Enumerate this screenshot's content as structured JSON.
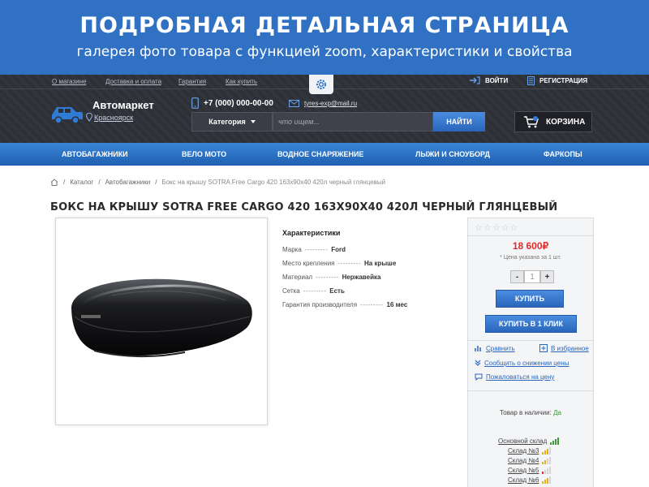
{
  "banner": {
    "title": "ПОДРОБНАЯ ДЕТАЛЬНАЯ СТРАНИЦА",
    "subtitle": "галерея фото товара с функцией zoom, характеристики и свойства"
  },
  "header": {
    "links": [
      "О магазине",
      "Доставка и оплата",
      "Гарантия",
      "Как купить"
    ],
    "login": "ВОЙТИ",
    "register": "РЕГИСТРАЦИЯ",
    "logo_name": "Автомаркет",
    "city": "Красноярск",
    "phone": "+7 (000) 000-00-00",
    "email": "tyres-exp@mail.ru",
    "category_label": "Категория",
    "search_placeholder": "что ищем...",
    "search_button": "НАЙТИ",
    "cart_label": "КОРЗИНА"
  },
  "nav": [
    "АВТОБАГАЖНИКИ",
    "ВЕЛО МОТО",
    "ВОДНОЕ СНАРЯЖЕНИЕ",
    "ЛЫЖИ И СНОУБОРД",
    "ФАРКОПЫ"
  ],
  "breadcrumb": {
    "separator": "/",
    "items": [
      "Каталог",
      "Автобагажники"
    ],
    "current": "Бокс на крышу SOTRA Free Cargo 420 163х90х40 420л черный глянцевый"
  },
  "product": {
    "title": "БОКС НА КРЫШУ SOTRA FREE CARGO 420 163Х90Х40 420Л ЧЕРНЫЙ ГЛЯНЦЕВЫЙ",
    "specs_title": "Характеристики",
    "specs": [
      {
        "name": "Марка",
        "value": "Ford"
      },
      {
        "name": "Место крепления",
        "value": "На крыше"
      },
      {
        "name": "Материал",
        "value": "Нержавейка"
      },
      {
        "name": "Сетка",
        "value": "Есть"
      },
      {
        "name": "Гарантия производителя",
        "value": "16 мес"
      }
    ]
  },
  "buy": {
    "rating": 0,
    "price": "18 600₽",
    "price_note": "* Цена указана за 1 шт.",
    "qty_minus": "-",
    "qty_value": "1",
    "qty_plus": "+",
    "buy_button": "КУПИТЬ",
    "one_click_button": "КУПИТЬ В 1 КЛИК",
    "compare": "Сравнить",
    "favorite": "В избранное",
    "notify": "Сообщить о снижении цены",
    "complain": "Пожаловаться на цену",
    "stock_label": "Товар в наличии:",
    "stock_value": "Да",
    "warehouses": [
      {
        "name": "Основной склад",
        "level": 4,
        "color": "#3a9a3a"
      },
      {
        "name": "Склад №3",
        "level": 3,
        "color": "#e8b020"
      },
      {
        "name": "Склад №4",
        "level": 2,
        "color": "#e8b020"
      },
      {
        "name": "Склад №5",
        "level": 1,
        "color": "#e03030"
      },
      {
        "name": "Склад №6",
        "level": 3,
        "color": "#e8b020"
      }
    ]
  },
  "colors": {
    "banner": "#3071c4",
    "header": "#2e3038",
    "accent": "#2a66bb",
    "price": "#e32b2b"
  }
}
